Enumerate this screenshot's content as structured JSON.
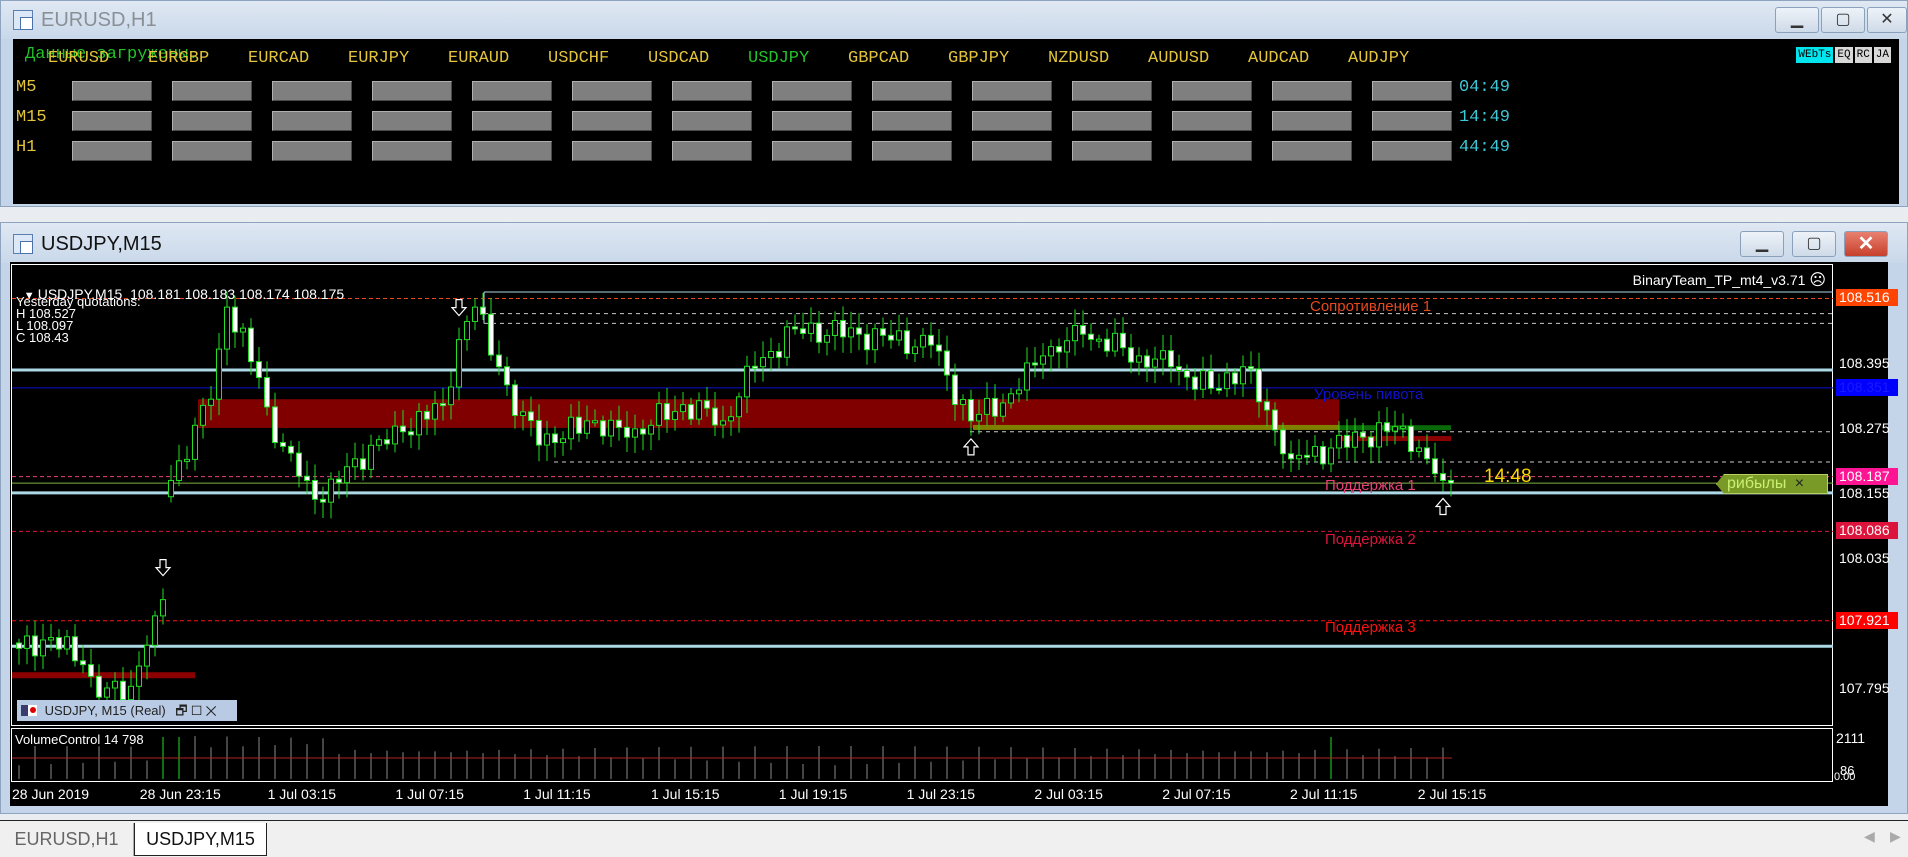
{
  "window_top": {
    "title": "EURUSD,H1",
    "status": "Данные загружены.",
    "pairs": [
      "EURUSD",
      "EURGBP",
      "EURCAD",
      "EURJPY",
      "EURAUD",
      "USDCHF",
      "USDCAD",
      "USDJPY",
      "GBPCAD",
      "GBPJPY",
      "NZDUSD",
      "AUDUSD",
      "AUDCAD",
      "AUDJPY"
    ],
    "active_pair": "USDJPY",
    "rows": [
      {
        "label": "M5",
        "time": "04:49"
      },
      {
        "label": "M15",
        "time": "14:49"
      },
      {
        "label": "H1",
        "time": "44:49"
      }
    ],
    "panel_buttons": [
      "WEbTs",
      "EQ",
      "RC",
      "JA"
    ],
    "colors": {
      "pair": "#e2c33a",
      "active_pair": "#22c32a",
      "status": "#22c32a",
      "timer": "#3cc8d8"
    }
  },
  "window_chart": {
    "title": "USDJPY,M15",
    "header": "USDJPY,M15  108.181 108.183 108.174 108.175",
    "indicator_name": "BinaryTeam_TP_mt4_v3.71",
    "yesterday": {
      "title": "Yesterday quotations:",
      "h": "H 108.527",
      "l": "L 108.097",
      "c": "C 108.43"
    },
    "timer": "14:48",
    "profit_label": "рибылы",
    "profit_close": "×",
    "subwindow_label": "USDJPY, M15 (Real)",
    "volume_label": "VolumeControl 14 798",
    "volume_axis": [
      "2111",
      "86",
      "0.00"
    ]
  },
  "levels": [
    {
      "name": "resistance-1",
      "label": "Сопротивление 1",
      "price": 108.516,
      "color": "#e8481e",
      "axis": "108.516",
      "axis_bg": "#ff4500"
    },
    {
      "name": "pivot",
      "label": "Уровень пивота",
      "price": 108.351,
      "color": "#1010d0",
      "axis": "108.351",
      "axis_bg": "#0000ff"
    },
    {
      "name": "support-1",
      "label": "Поддержка 1",
      "price": 108.187,
      "color": "#e8407a",
      "axis": "108.187",
      "axis_bg": "#ff1493"
    },
    {
      "name": "support-2",
      "label": "Поддержка 2",
      "price": 108.086,
      "color": "#dc143c",
      "axis": "108.086",
      "axis_bg": "#dc143c"
    },
    {
      "name": "support-3",
      "label": "Поддержка 3",
      "price": 107.921,
      "color": "#ff1010",
      "axis": "107.921",
      "axis_bg": "#ff0000"
    }
  ],
  "chart_data": {
    "type": "candlestick",
    "symbol": "USDJPY",
    "timeframe": "M15",
    "ylim": [
      107.72,
      108.585
    ],
    "price_ticks": [
      "108.395",
      "108.275",
      "108.155",
      "108.035",
      "107.795"
    ],
    "price_tick_values": [
      108.395,
      108.275,
      108.155,
      108.035,
      107.795
    ],
    "time_labels": [
      "28 Jun 2019",
      "28 Jun 23:15",
      "1 Jul 03:15",
      "1 Jul 07:15",
      "1 Jul 11:15",
      "1 Jul 15:15",
      "1 Jul 19:15",
      "1 Jul 23:15",
      "2 Jul 03:15",
      "2 Jul 07:15",
      "2 Jul 11:15",
      "2 Jul 15:15"
    ],
    "bars": 180,
    "close_anchors": [
      [
        0,
        107.87
      ],
      [
        4,
        107.89
      ],
      [
        8,
        107.84
      ],
      [
        10,
        107.78
      ],
      [
        14,
        107.8
      ],
      [
        17,
        107.93
      ],
      [
        18,
        107.96
      ],
      [
        19,
        108.18
      ],
      [
        24,
        108.33
      ],
      [
        26,
        108.5
      ],
      [
        30,
        108.37
      ],
      [
        32,
        108.25
      ],
      [
        36,
        108.18
      ],
      [
        38,
        108.14
      ],
      [
        42,
        108.22
      ],
      [
        48,
        108.27
      ],
      [
        53,
        108.32
      ],
      [
        55,
        108.44
      ],
      [
        57,
        108.5
      ],
      [
        60,
        108.39
      ],
      [
        62,
        108.3
      ],
      [
        67,
        108.25
      ],
      [
        71,
        108.29
      ],
      [
        76,
        108.26
      ],
      [
        83,
        108.32
      ],
      [
        88,
        108.29
      ],
      [
        92,
        108.39
      ],
      [
        97,
        108.46
      ],
      [
        105,
        108.45
      ],
      [
        114,
        108.43
      ],
      [
        119,
        108.29
      ],
      [
        124,
        108.34
      ],
      [
        128,
        108.41
      ],
      [
        133,
        108.45
      ],
      [
        140,
        108.41
      ],
      [
        144,
        108.39
      ],
      [
        149,
        108.35
      ],
      [
        153,
        108.39
      ],
      [
        156,
        108.31
      ],
      [
        159,
        108.22
      ],
      [
        164,
        108.24
      ],
      [
        168,
        108.26
      ],
      [
        173,
        108.28
      ],
      [
        176,
        108.22
      ],
      [
        178,
        108.18
      ],
      [
        179,
        108.175
      ]
    ],
    "last_close": 108.175,
    "extra_lines": [
      {
        "kind": "yesterday-high",
        "price": 108.528,
        "color": "#add8e6"
      },
      {
        "kind": "band",
        "price": 108.384,
        "color": "#add8e6"
      },
      {
        "kind": "band",
        "price": 108.157,
        "color": "#add8e6"
      },
      {
        "kind": "band",
        "price": 107.874,
        "color": "#add8e6"
      },
      {
        "kind": "dotted",
        "price": 108.488,
        "color": "#c8c8c8"
      },
      {
        "kind": "dotted",
        "price": 108.47,
        "color": "#c8c8c8"
      },
      {
        "kind": "dotted",
        "price": 108.27,
        "color": "#c8c8c8"
      },
      {
        "kind": "dotted",
        "price": 108.214,
        "color": "#c8c8c8"
      },
      {
        "kind": "current",
        "price": 108.175,
        "color": "#7cb342"
      }
    ],
    "zone": {
      "from": 108.277,
      "to": 108.33,
      "color": "#800000"
    },
    "arrows": [
      {
        "bar": 18,
        "dir": "down"
      },
      {
        "bar": 55,
        "dir": "down"
      },
      {
        "bar": 119,
        "dir": "up"
      },
      {
        "bar": 178,
        "dir": "up"
      }
    ],
    "volume_highlight_bars": [
      19,
      164
    ]
  },
  "tabs": [
    {
      "label": "EURUSD,H1",
      "active": false
    },
    {
      "label": "USDJPY,M15",
      "active": true
    }
  ]
}
